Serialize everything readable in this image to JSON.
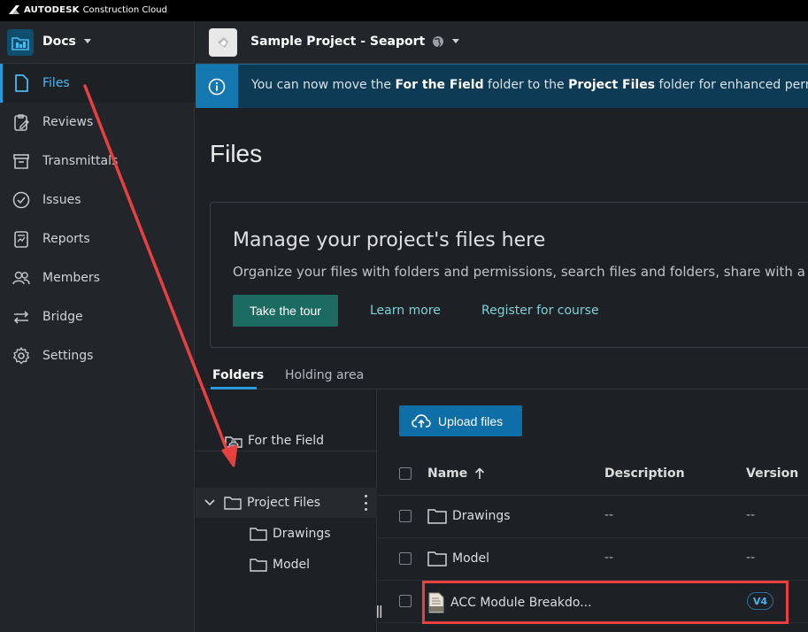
{
  "topbar": {
    "brand_bold": "AUTODESK",
    "brand_rest": "Construction Cloud"
  },
  "sidebar": {
    "product": "Docs",
    "items": [
      {
        "label": "Files",
        "icon": "file-icon",
        "active": true
      },
      {
        "label": "Reviews",
        "icon": "reviews-icon"
      },
      {
        "label": "Transmittals",
        "icon": "transmittals-icon"
      },
      {
        "label": "Issues",
        "icon": "issues-icon"
      },
      {
        "label": "Reports",
        "icon": "reports-icon"
      },
      {
        "label": "Members",
        "icon": "members-icon"
      },
      {
        "label": "Bridge",
        "icon": "bridge-icon"
      },
      {
        "label": "Settings",
        "icon": "gear-icon"
      }
    ]
  },
  "project": {
    "name": "Sample Project - Seaport"
  },
  "banner": {
    "t1": "You can now move the ",
    "b1": "For the Field",
    "t2": " folder to the ",
    "b2": "Project Files",
    "t3": " folder for enhanced permission c"
  },
  "page": {
    "title": "Files"
  },
  "card": {
    "title": "Manage your project's files here",
    "subtitle": "Organize your files with folders and permissions, search files and folders, share with a",
    "tour_button": "Take the tour",
    "learn_more": "Learn more",
    "register": "Register for course"
  },
  "tabs": {
    "folders": "Folders",
    "holding": "Holding area"
  },
  "tree": {
    "for_field": "For the Field",
    "project_files": "Project Files",
    "drawings": "Drawings",
    "model": "Model"
  },
  "list": {
    "upload_button": "Upload files",
    "headers": {
      "name": "Name",
      "description": "Description",
      "version": "Version"
    },
    "rows": [
      {
        "name": "Drawings",
        "description": "--",
        "version": "--"
      },
      {
        "name": "Model",
        "description": "--",
        "version": "--"
      },
      {
        "name": "ACC Module Breakdo...",
        "version": "V4"
      }
    ]
  },
  "colors": {
    "accent": "#2a9ad9",
    "tour_button": "#1c6b63",
    "annotation": "#e8403f"
  }
}
